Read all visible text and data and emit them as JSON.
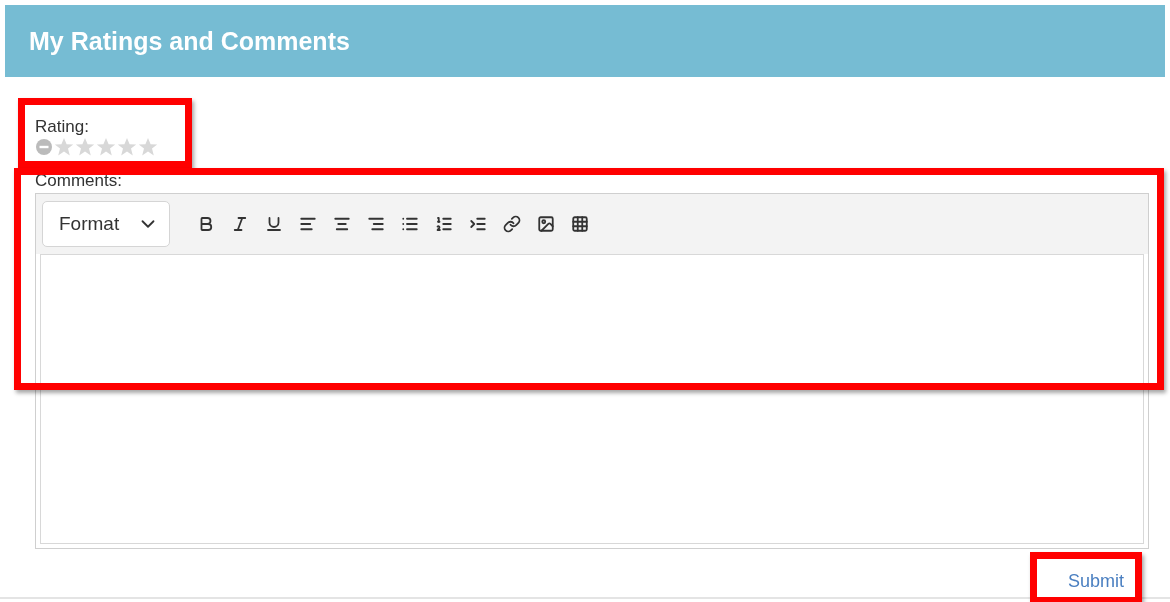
{
  "header": {
    "title": "My Ratings and Comments"
  },
  "rating": {
    "label": "Rating:",
    "stars": 0
  },
  "comments": {
    "label": "Comments:",
    "format_select": "Format"
  },
  "submit": {
    "label": "Submit"
  }
}
